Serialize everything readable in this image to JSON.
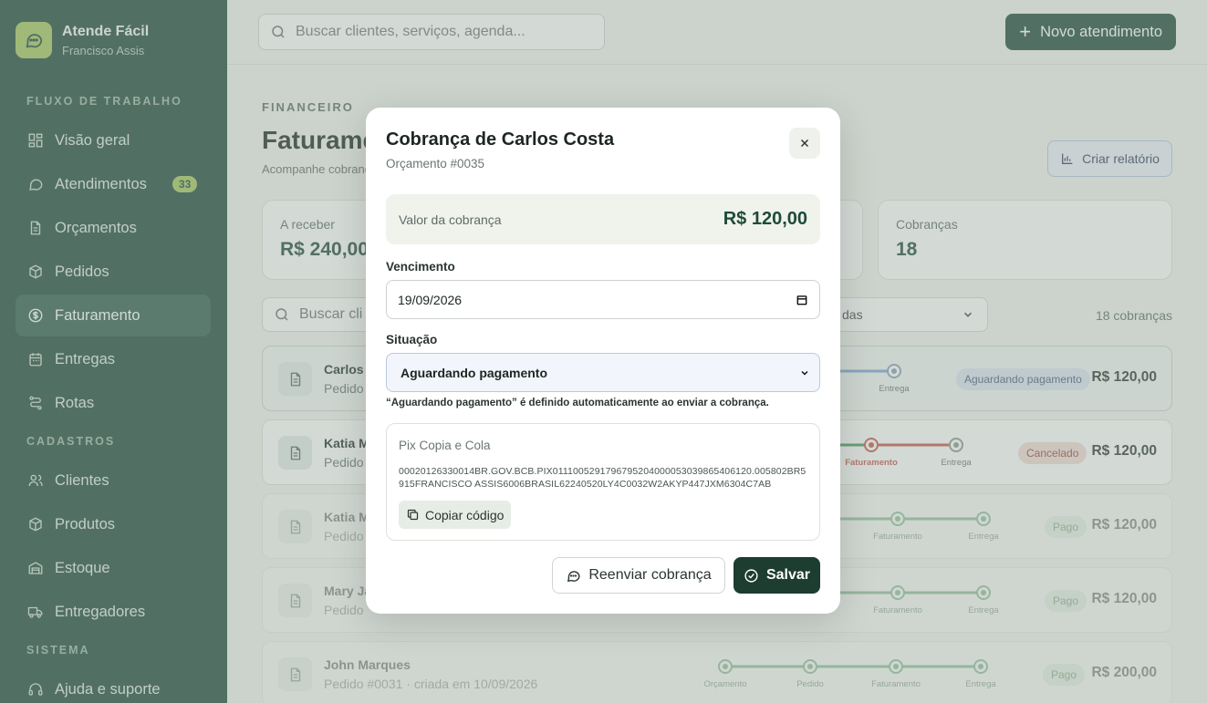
{
  "brand": {
    "name": "Atende Fácil",
    "user": "Francisco Assis"
  },
  "sidebar": {
    "sections": [
      "FLUXO DE TRABALHO",
      "CADASTROS",
      "SISTEMA"
    ],
    "items": [
      {
        "label": "Visão geral",
        "icon": "grid-icon"
      },
      {
        "label": "Atendimentos",
        "icon": "chat-icon",
        "badge": "33"
      },
      {
        "label": "Orçamentos",
        "icon": "document-icon"
      },
      {
        "label": "Pedidos",
        "icon": "box-icon"
      },
      {
        "label": "Faturamento",
        "icon": "dollar-icon",
        "active": true
      },
      {
        "label": "Entregas",
        "icon": "calendar-icon"
      },
      {
        "label": "Rotas",
        "icon": "route-icon"
      },
      {
        "label": "Clientes",
        "icon": "users-icon"
      },
      {
        "label": "Produtos",
        "icon": "box-icon"
      },
      {
        "label": "Estoque",
        "icon": "warehouse-icon"
      },
      {
        "label": "Entregadores",
        "icon": "truck-icon"
      },
      {
        "label": "Ajuda e suporte",
        "icon": "headset-icon"
      }
    ]
  },
  "topbar": {
    "search_placeholder": "Buscar clientes, serviços, agenda...",
    "new_button": "Novo atendimento"
  },
  "page": {
    "eyebrow": "FINANCEIRO",
    "title": "Faturamento",
    "subtitle": "Acompanhe cobranças",
    "report_button": "Criar relatório"
  },
  "stats": [
    {
      "label": "A receber",
      "value": "R$ 240,00"
    },
    {
      "label": "Cobranças",
      "value": "18"
    }
  ],
  "filters": {
    "search_placeholder": "Buscar cli",
    "select_value": "das",
    "count": "18 cobranças"
  },
  "timeline_steps": [
    "Orçamento",
    "Pedido",
    "Faturamento",
    "Entrega"
  ],
  "rows": [
    {
      "name": "Carlos C",
      "sub": "Pedido",
      "status": "Aguardando pagamento",
      "amount": "R$ 120,00"
    },
    {
      "name": "Katia M",
      "sub": "Pedido",
      "status": "Cancelado",
      "amount": "R$ 120,00"
    },
    {
      "name": "Katia M",
      "sub": "Pedido",
      "status": "Pago",
      "amount": "R$ 120,00"
    },
    {
      "name": "Mary Ja",
      "sub": "Pedido",
      "status": "Pago",
      "amount": "R$ 120,00"
    },
    {
      "name": "John Marques",
      "sub": "Pedido #0031 · criada em 10/09/2026",
      "status": "Pago",
      "amount": "R$ 200,00"
    }
  ],
  "modal": {
    "title": "Cobrança de Carlos Costa",
    "subtitle": "Orçamento #0035",
    "amount_label": "Valor da cobrança",
    "amount_value": "R$ 120,00",
    "due_label": "Vencimento",
    "due_value": "19/09/2026",
    "status_label": "Situação",
    "status_value": "Aguardando pagamento",
    "status_hint": "“Aguardando pagamento” é definido automaticamente ao enviar a cobrança.",
    "pix_label": "Pix Copia e Cola",
    "pix_code": "00020126330014BR.GOV.BCB.PIX0111005291796795204000053039865406120.005802BR5915FRANCISCO ASSIS6006BRASIL62240520LY4C0032W2AKYP447JXM6304C7AB",
    "copy_button": "Copiar código",
    "resend_button": "Reenviar cobrança",
    "save_button": "Salvar"
  },
  "colors": {
    "sidebar": "#1f4a3b",
    "accent": "#a9c95f",
    "primary": "#1c3d30",
    "cancel": "#c45a4a"
  }
}
